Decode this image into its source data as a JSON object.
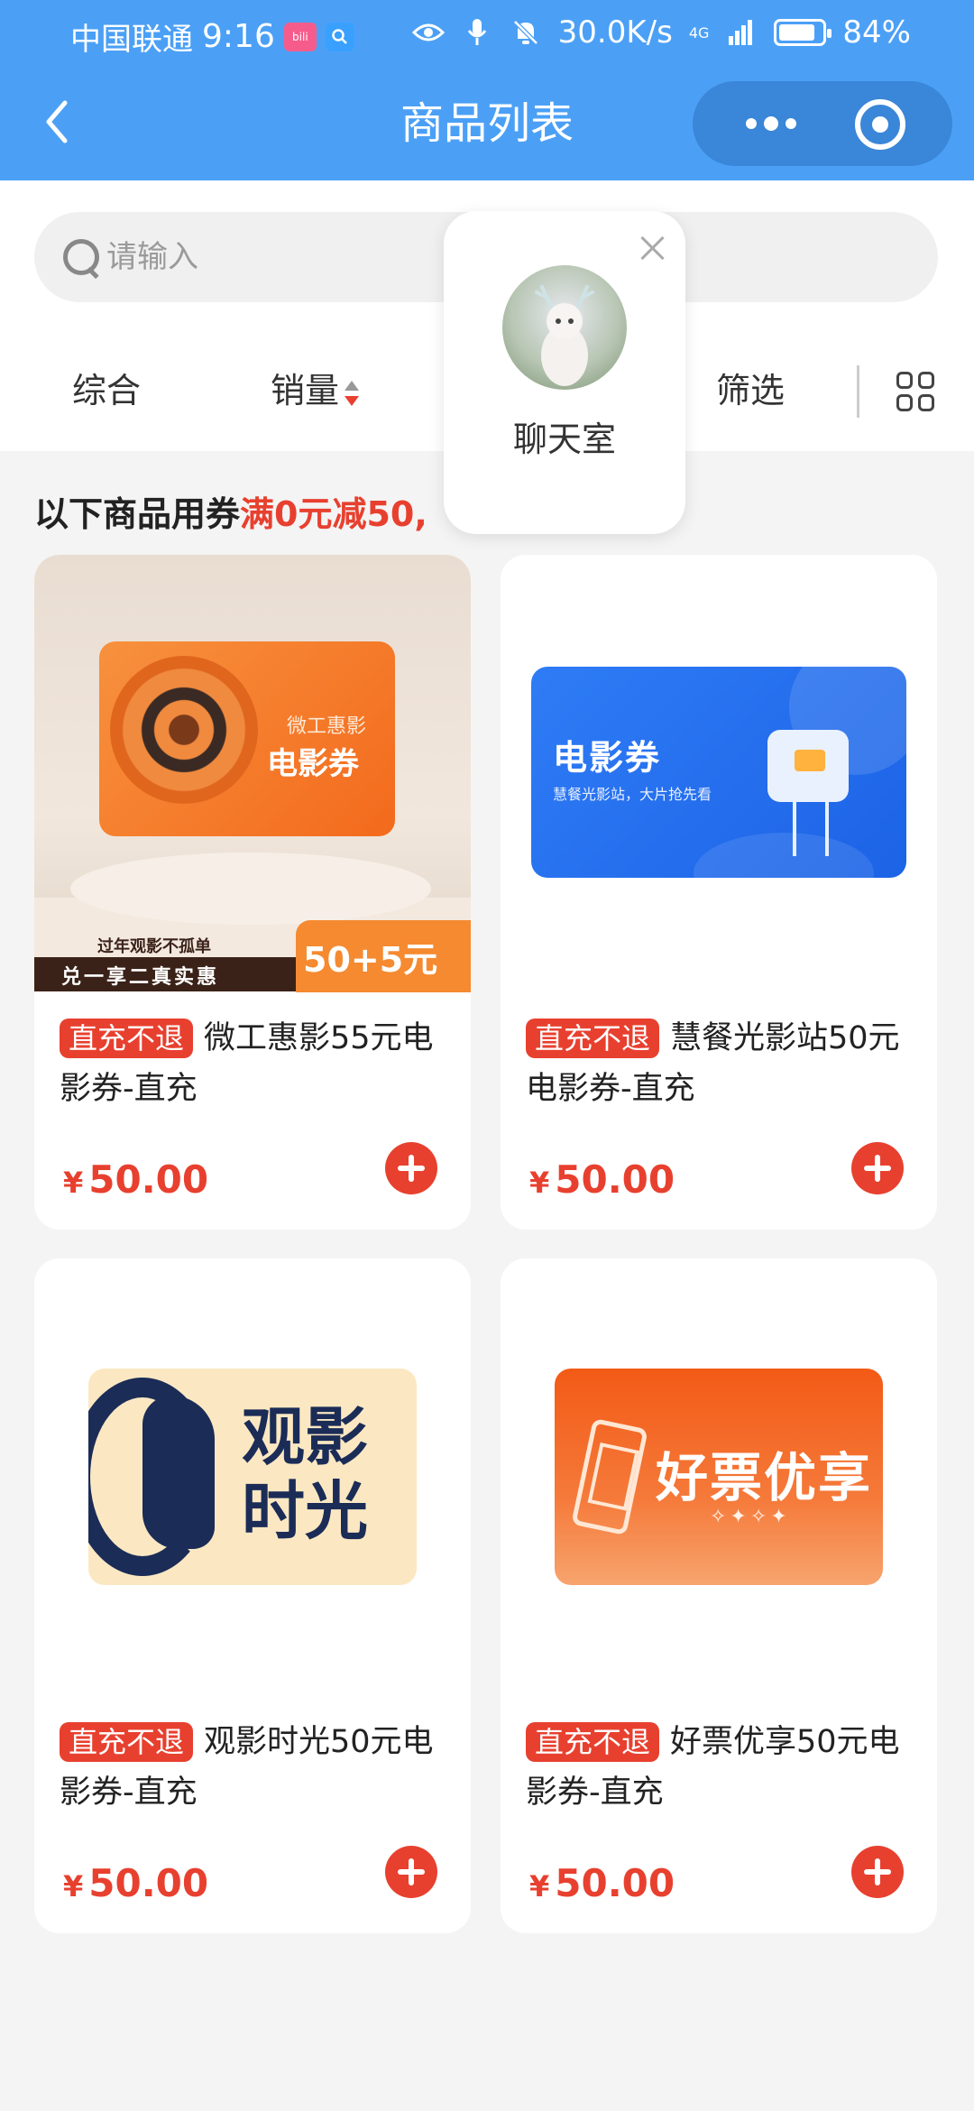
{
  "status_bar": {
    "carrier": "中国联通",
    "time": "9:16",
    "net_speed": "30.0K/s",
    "signal": "4G",
    "battery": "84%",
    "battery_level": 0.84
  },
  "header": {
    "title": "商品列表"
  },
  "search": {
    "placeholder": "请输入"
  },
  "tabs": {
    "comprehensive": "综合",
    "sales": "销量",
    "filter": "筛选"
  },
  "coupon": {
    "prefix": "以下商品用券",
    "highlight": "满0元减50,"
  },
  "chat_popup": {
    "label": "聊天室"
  },
  "products": [
    {
      "tag": "直充不退",
      "name": "微工惠影55元电影券-直充",
      "price_symbol": "¥",
      "price": "50.00",
      "image": {
        "small": "微工惠影",
        "big": "电影券",
        "banner_top": "过年观影不孤单",
        "banner": "兑一享二真实惠",
        "promo": "50+5元"
      }
    },
    {
      "tag": "直充不退",
      "name": "慧餐光影站50元电影券-直充",
      "price_symbol": "¥",
      "price": "50.00",
      "image": {
        "title": "电影券",
        "subtitle": "慧餐光影站，大片抢先看"
      }
    },
    {
      "tag": "直充不退",
      "name": "观影时光50元电影券-直充",
      "price_symbol": "¥",
      "price": "50.00",
      "image": {
        "line1": "观影",
        "line2": "时光"
      }
    },
    {
      "tag": "直充不退",
      "name": "好票优享50元电影券-直充",
      "price_symbol": "¥",
      "price": "50.00",
      "image": {
        "title": "好票优享"
      }
    }
  ],
  "colors": {
    "header_bg": "#4ba0f6",
    "accent_red": "#e8402f",
    "page_bg": "#f4f4f4"
  },
  "icons": {
    "back": "chevron-left-icon",
    "more": "more-dots-icon",
    "close_miniprogram": "target-circle-icon",
    "search": "search-icon",
    "sort": "sort-arrows-icon",
    "grid": "grid-view-icon",
    "add": "plus-circle-icon",
    "close": "close-icon"
  }
}
